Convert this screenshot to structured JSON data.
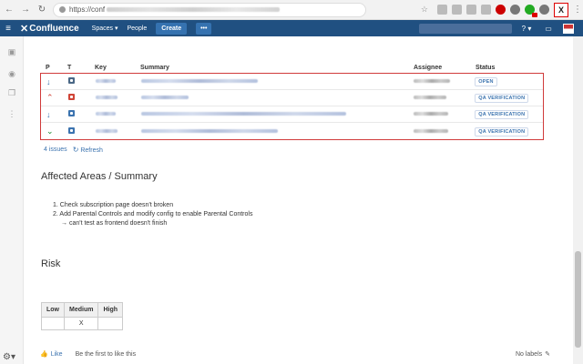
{
  "browser": {
    "url_visible": "https://conf",
    "icons": {
      "back": "back-arrow-icon",
      "forward": "forward-arrow-icon",
      "reload": "reload-icon"
    }
  },
  "header": {
    "logo": "Confluence",
    "nav": [
      "Spaces",
      "People"
    ],
    "create_label": "Create",
    "more_label": "•••",
    "help_icon": "?",
    "colors": {
      "bar": "#205081",
      "button": "#3572b0"
    }
  },
  "jira_table": {
    "columns": [
      "P",
      "T",
      "Key",
      "Summary",
      "Assignee",
      "Status"
    ],
    "rows": [
      {
        "priority": "low",
        "type": "task",
        "status": "OPEN"
      },
      {
        "priority": "high",
        "type": "bug",
        "status": "QA VERIFICATION"
      },
      {
        "priority": "low",
        "type": "story",
        "status": "QA VERIFICATION"
      },
      {
        "priority": "trivial",
        "type": "story",
        "status": "QA VERIFICATION"
      }
    ],
    "issues_count": "4 issues",
    "refresh_label": "Refresh"
  },
  "affected": {
    "heading": "Affected Areas / Summary",
    "items": [
      "1. Check subscription page doesn't broken",
      "2. Add Parental Controls and modify config to enable Parental Controls"
    ],
    "sub_item": "→ can't test as frontend doesn't finish"
  },
  "risk": {
    "heading": "Risk",
    "headers": [
      "Low",
      "Medium",
      "High"
    ],
    "values": [
      "",
      "X",
      ""
    ]
  },
  "footer": {
    "like_label": "Like",
    "first_like": "Be the first to like this",
    "labels": "No labels"
  }
}
